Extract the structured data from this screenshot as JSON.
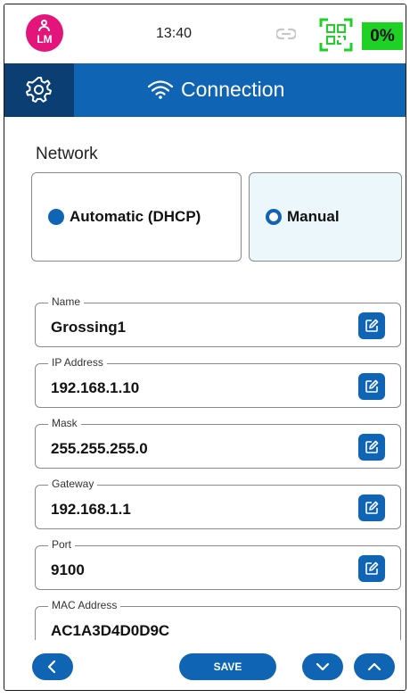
{
  "status": {
    "user_initials": "LM",
    "time": "13:40",
    "battery": "0%"
  },
  "header": {
    "title": "Connection"
  },
  "network": {
    "label": "Network",
    "modes": [
      {
        "label": "Automatic (DHCP)",
        "selected": true
      },
      {
        "label": "Manual",
        "selected": false
      }
    ]
  },
  "fields": {
    "name": {
      "label": "Name",
      "value": "Grossing1"
    },
    "ip": {
      "label": "IP Address",
      "value": "192.168.1.10"
    },
    "mask": {
      "label": "Mask",
      "value": "255.255.255.0"
    },
    "gateway": {
      "label": "Gateway",
      "value": "192.168.1.1"
    },
    "port": {
      "label": "Port",
      "value": "9100"
    },
    "mac": {
      "label": "MAC Address",
      "value": "AC1A3D4D0D9C"
    }
  },
  "footer": {
    "save_label": "SAVE"
  },
  "colors": {
    "primary": "#0f64b4",
    "primary_dark": "#0b3f73",
    "avatar": "#e4157a",
    "battery": "#1fd125",
    "qr": "#1fd125",
    "manual_bg": "#ebf7fb"
  },
  "icons": [
    "user-icon",
    "link-icon",
    "qr-code-icon",
    "gear-icon",
    "wifi-icon",
    "edit-icon",
    "chevron-left-icon",
    "chevron-down-icon",
    "chevron-up-icon"
  ]
}
